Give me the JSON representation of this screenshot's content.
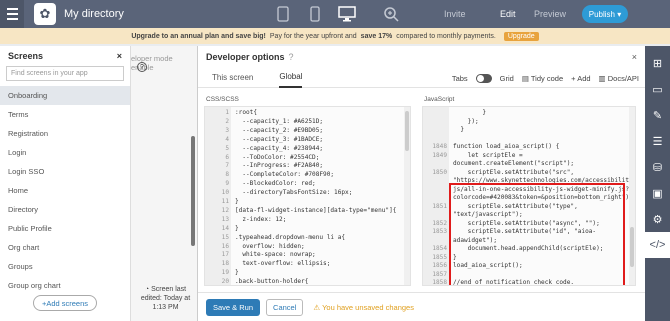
{
  "app": {
    "title": "My directory"
  },
  "topbar": {
    "invite": "Invite",
    "edit": "Edit",
    "preview": "Preview",
    "publish": "Publish ▾"
  },
  "promo": {
    "bold1": "Upgrade to an annual plan and save big!",
    "text1": "Pay for the year upfront and",
    "bold2": "save 17%",
    "text2": "compared to monthly payments.",
    "button": "Upgrade"
  },
  "screens": {
    "title": "Screens",
    "search_placeholder": "Find screens in your app",
    "items": [
      "Onboarding",
      "Terms",
      "Registration",
      "Login",
      "Login SSO",
      "Home",
      "Directory",
      "Public Profile",
      "Org chart",
      "Groups",
      "Group org chart"
    ],
    "add_button": "+Add screens",
    "edited": "Screen last edited: Today at 1:13 PM"
  },
  "mid": {
    "hint": "eloper mode enable"
  },
  "panel": {
    "title": "Developer options",
    "tabs": [
      "This screen",
      "Global"
    ],
    "tools": {
      "tabs": "Tabs",
      "grid": "Grid",
      "tidy": "Tidy code",
      "add": "Add",
      "docs": "Docs/API"
    },
    "css_label": "CSS/SCSS",
    "js_label": "JavaScript",
    "save": "Save & Run",
    "cancel": "Cancel",
    "warning": "You have unsaved changes"
  },
  "css_lines": [
    {
      "n": "1",
      "t": ":root{"
    },
    {
      "n": "2",
      "t": "  --capacity_1: #A6251D;"
    },
    {
      "n": "3",
      "t": "  --capacity_2: #E9BD05;"
    },
    {
      "n": "4",
      "t": "  --capacity_3: #1BADCE;"
    },
    {
      "n": "5",
      "t": "  --capacity_4: #238944;"
    },
    {
      "n": "6",
      "t": "  --ToDoColor: #2554CD;"
    },
    {
      "n": "7",
      "t": "  --InProgress: #F2A840;"
    },
    {
      "n": "8",
      "t": "  --CompleteColor: #708F90;"
    },
    {
      "n": "9",
      "t": "  --BlockedColor: red;"
    },
    {
      "n": "10",
      "t": "  --directoryTabsFontSize: 16px;"
    },
    {
      "n": "11",
      "t": "}"
    },
    {
      "n": "12",
      "t": "[data-fl-widget-instance][data-type=\"menu\"]{"
    },
    {
      "n": "13",
      "t": "  z-index: 12;"
    },
    {
      "n": "14",
      "t": "}"
    },
    {
      "n": "15",
      "t": ".typeahead.dropdown-menu li a{"
    },
    {
      "n": "16",
      "t": "  overflow: hidden;"
    },
    {
      "n": "17",
      "t": "  white-space: nowrap;"
    },
    {
      "n": "18",
      "t": "  text-overflow: ellipsis;"
    },
    {
      "n": "19",
      "t": "}"
    },
    {
      "n": "20",
      "t": ".back-button-holder{"
    }
  ],
  "js_lines": [
    {
      "n": "",
      "t": "        }"
    },
    {
      "n": "",
      "t": "    });"
    },
    {
      "n": "",
      "t": "  }"
    },
    {
      "n": "",
      "t": ""
    },
    {
      "n": "1848",
      "t": "function load_aioa_script() {"
    },
    {
      "n": "1849",
      "t": "    let scriptEle ="
    },
    {
      "n": "",
      "t": "document.createElement(\"script\");"
    },
    {
      "n": "1850",
      "t": "    scriptEle.setAttribute(\"src\","
    },
    {
      "n": "",
      "t": "\"https://www.skynettechnologies.com/accessibility/"
    },
    {
      "n": "",
      "t": "js/all-in-one-accessibility-js-widget-minify.js?"
    },
    {
      "n": "",
      "t": "colorcode=#420083&token=&position=bottom_right\");"
    },
    {
      "n": "1851",
      "t": "    scriptEle.setAttribute(\"type\","
    },
    {
      "n": "",
      "t": "\"text/javascript\");"
    },
    {
      "n": "1852",
      "t": "    scriptEle.setAttribute(\"async\", \"\");"
    },
    {
      "n": "1853",
      "t": "    scriptEle.setAttribute(\"id\", \"aioa-"
    },
    {
      "n": "",
      "t": "adawidget\");"
    },
    {
      "n": "1854",
      "t": "    document.head.appendChild(scriptEle);"
    },
    {
      "n": "1855",
      "t": "}"
    },
    {
      "n": "1856",
      "t": "load_aioa_script();"
    },
    {
      "n": "1857",
      "t": ""
    },
    {
      "n": "1858",
      "t": "//end of notification check code."
    }
  ]
}
